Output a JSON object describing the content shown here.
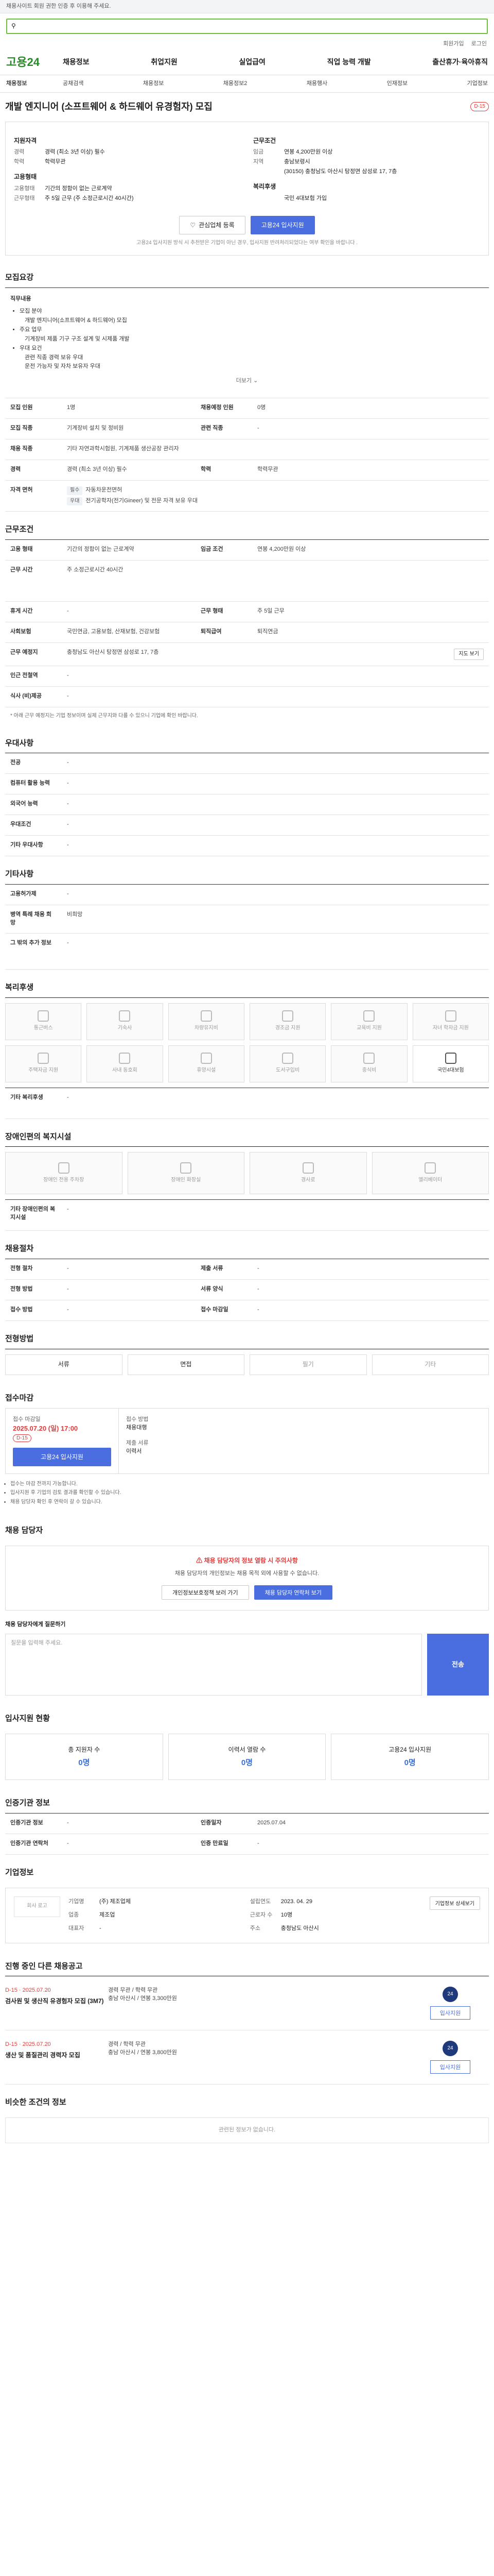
{
  "topbar": {
    "text": "채용사이트 회원 권한 인증 후 이용해 주세요."
  },
  "search": {
    "placeholder": "",
    "button": "검색"
  },
  "util": {
    "links": [
      "회원가입",
      "로그인"
    ]
  },
  "gnb": {
    "logo": "고용24",
    "menu": [
      "채용정보",
      "취업지원",
      "실업급여",
      "직업 능력 개발",
      "출산휴가·육아휴직"
    ]
  },
  "subnav": {
    "first": "채용정보",
    "items": [
      "공채검색",
      "채용정보",
      "채용정보2",
      "채용행사",
      "인재정보",
      "기업정보"
    ]
  },
  "title": {
    "text": "개발 엔지니어 (소프트웨어 & 하드웨어 유경험자) 모집",
    "dday": "D-15"
  },
  "summary": {
    "left_title": "지원자격",
    "left": [
      {
        "k": "경력",
        "v": "경력 (최소 3년 이상) 필수"
      },
      {
        "k": "학력",
        "v": "학력무관"
      }
    ],
    "left2_title": "고용형태",
    "left2": [
      {
        "k": "고용형태",
        "v": "기간의 정함이 없는 근로계약"
      },
      {
        "k": "근무형태",
        "v": "주 5일 근무 (주 소정근로시간 40시간)"
      }
    ],
    "right_title": "근무조건",
    "right": [
      {
        "k": "임금",
        "v": "연봉 4,200만원 이상"
      },
      {
        "k": "지역",
        "v": "충남보령시"
      },
      {
        "k": "",
        "v": "(30150) 충청남도 아산시 탕정면 삼성로 17, 7층"
      }
    ],
    "right2_title": "복리후생",
    "right2": [
      {
        "k": "",
        "v": "국민 4대보험 가입"
      }
    ]
  },
  "actions": {
    "save": "관심업체 등록",
    "apply": "고용24 입사지원",
    "notice": "고용24 입사지원 방식 시 추천받은 기업이 아닌 경우, 입사지원 반려처리되었다는 여부 확인을 바랍니다 ."
  },
  "recruit": {
    "title": "모집요강",
    "desc_title": "직무내용",
    "desc": [
      "모집 분야",
      "개발 엔지니어(소프트웨어 & 하드웨어) 모집",
      "주요 업무",
      "기계장비 제품 기구 구조 설계 및 시제품 개발",
      "우대 요건",
      "관련 직종 경력 보유 우대",
      "운전 가능자 및 자차 보유자 우대"
    ],
    "more": "더보기",
    "rows": [
      {
        "k": "모집 인원",
        "v": "1명",
        "k2": "채용예정 인원",
        "v2": "0명"
      },
      {
        "k": "모집 직종",
        "v": "기계장비 설치 및 정비원",
        "k2": "관련 직종",
        "v2": "-"
      },
      {
        "k": "채용 직종",
        "v": "기타 자연과학시험원, 기계제품 생산공장 관리자",
        "k2": "",
        "v2": ""
      },
      {
        "k": "경력",
        "v": "경력 (최소 3년 이상) 필수",
        "k2": "학력",
        "v2": "학력무관"
      }
    ],
    "cert_k": "자격 면허",
    "cert_tag": "필수",
    "cert_v": "자동차운전면허",
    "cert_tag2": "우대",
    "cert_v2": "전기공학자(전기Gineer) 및 전문 자격 보유 우대"
  },
  "work": {
    "title": "근무조건",
    "rows": [
      {
        "k": "고용 형태",
        "v": "기간의 정함이 없는 근로계약",
        "k2": "임금 조건",
        "v2": "연봉 4,200만원 이상"
      },
      {
        "k": "근무 시간",
        "v": "주 소정근로시간 40시간",
        "k2": "",
        "v2": ""
      },
      {
        "k": "휴게 시간",
        "v": "-",
        "k2": "근무 형태",
        "v2": "주 5일 근무"
      },
      {
        "k": "사회보험",
        "v": "국민연금, 고용보험, 산재보험, 건강보험",
        "k2": "퇴직급여",
        "v2": "퇴직연금"
      },
      {
        "k": "근무 예정지",
        "v": "충청남도 아산시 탕정면 삼성로 17, 7층",
        "k2": "",
        "v2": ""
      },
      {
        "k": "인근 전철역",
        "v": "-",
        "k2": "",
        "v2": ""
      },
      {
        "k": "식사 (비)제공",
        "v": "-",
        "k2": "",
        "v2": ""
      }
    ],
    "map_button": "지도 보기",
    "note": "* 아래 근무 예정지는 기업 정보이며 실제 근무지와 다를 수 있으니 기업에 확인 바랍니다."
  },
  "pref": {
    "title": "우대사항",
    "rows": [
      {
        "k": "전공",
        "v": "-"
      },
      {
        "k": "컴퓨터 활용 능력",
        "v": "-"
      },
      {
        "k": "외국어 능력",
        "v": "-"
      },
      {
        "k": "우대조건",
        "v": "-"
      },
      {
        "k": "기타 우대사항",
        "v": "-"
      }
    ]
  },
  "etc": {
    "title": "기타사항",
    "rows": [
      {
        "k": "고용허가제",
        "v": "-"
      },
      {
        "k": "병역 특례 채용 희망",
        "v": "비희망"
      },
      {
        "k": "그 밖의 추가 정보",
        "v": "-"
      }
    ]
  },
  "welfare": {
    "title": "복리후생",
    "items": [
      {
        "label": "통근버스",
        "on": false
      },
      {
        "label": "기숙사",
        "on": false
      },
      {
        "label": "차량유지비",
        "on": false
      },
      {
        "label": "경조금 지원",
        "on": false
      },
      {
        "label": "교육비 지원",
        "on": false
      },
      {
        "label": "자녀 학자금 지원",
        "on": false
      },
      {
        "label": "주택자금 지원",
        "on": false
      },
      {
        "label": "사내 동호회",
        "on": false
      },
      {
        "label": "휴양시설",
        "on": false
      },
      {
        "label": "도서구입비",
        "on": false
      },
      {
        "label": "중식비",
        "on": false
      },
      {
        "label": "국민4대보험",
        "on": true
      }
    ],
    "other_k": "기타 복리후생",
    "other_v": "-"
  },
  "disabled": {
    "title": "장애인편의 복지시설",
    "items": [
      "장애인 전용 주차장",
      "장애인 화장실",
      "경사로",
      "엘리베이터"
    ],
    "other_k": "기타 장애인편의 복지시설",
    "other_v": "-"
  },
  "location": {
    "title": "채용절차",
    "rows": [
      {
        "k": "전형 절차",
        "v": "-",
        "k2": "제출 서류",
        "v2": "-"
      },
      {
        "k": "전형 방법",
        "v": "-",
        "k2": "서류 양식",
        "v2": "-"
      },
      {
        "k": "접수 방법",
        "v": "-",
        "k2": "접수 마감일",
        "v2": "-"
      }
    ]
  },
  "process": {
    "title": "전형방법",
    "tabs": [
      {
        "label": "서류",
        "on": true
      },
      {
        "label": "면접",
        "on": true
      },
      {
        "label": "필기",
        "on": false
      },
      {
        "label": "기타",
        "on": false
      }
    ]
  },
  "apply": {
    "title": "접수마감",
    "deadline_label": "접수 마감일",
    "deadline": "2025.07.20 (일) 17:00",
    "dday": "D-15",
    "btn": "고용24 입사지원",
    "method_label": "접수 방법",
    "method": "채용대행",
    "docs_label": "제출 서류",
    "docs": "이력서",
    "notes": [
      "접수는 마감 전까지 가능합니다.",
      "입사지원 후 기업의 검토 결과를 확인할 수 있습니다.",
      "채용 담당자 확인 후 연락이 갈 수 있습니다."
    ]
  },
  "manager": {
    "title": "채용 담당자",
    "notice_title": "채용 담당자의 정보 열람 시 주의사항",
    "notice": "채용 담당자의 개인정보는 채용 목적 외에 사용할 수 없습니다.",
    "btn1": "개인정보보호정책 보러 가기",
    "btn2": "채용 담당자 연락처 보기"
  },
  "qa": {
    "title": "채용 담당자에게 질문하기",
    "placeholder": "질문을 입력해 주세요.",
    "btn": "전송"
  },
  "stats": {
    "title": "입사지원 현황",
    "items": [
      {
        "label": "총 지원자 수",
        "n": "0명"
      },
      {
        "label": "이력서 열람 수",
        "n": "0명"
      },
      {
        "label": "고용24 입사지원",
        "n": "0명"
      }
    ]
  },
  "agency": {
    "title": "인증기관 정보",
    "rows": [
      {
        "k": "인증기관 정보",
        "v": "-",
        "k2": "인증일자",
        "v2": "2025.07.04"
      },
      {
        "k": "인증기관 연락처",
        "v": "-",
        "k2": "인증 만료일",
        "v2": "-"
      }
    ]
  },
  "company": {
    "title": "기업정보",
    "logo": "회사 로고",
    "rows": [
      {
        "k": "기업명",
        "v": "(주) 제조업체"
      },
      {
        "k": "업종",
        "v": "제조업"
      },
      {
        "k": "대표자",
        "v": "-"
      },
      {
        "k": "근로자 수",
        "v": "10명"
      },
      {
        "k": "설립연도",
        "v": "2023. 04. 29"
      },
      {
        "k": "주소",
        "v": "충청남도 아산시"
      }
    ],
    "btn": "기업정보 상세보기"
  },
  "other_jobs": {
    "title": "진행 중인 다른 채용공고",
    "items": [
      {
        "dday": "D-15",
        "date": "2025.07.20",
        "name": "검사원 및 생산직 유경험자 모집 (3M7)",
        "exp": "경력 무관",
        "edu": "학력 무관",
        "region": "충남 아산시",
        "wage": "연봉 3,300만원",
        "btn": "입사지원"
      },
      {
        "dday": "D-15",
        "date": "2025.07.20",
        "name": "생산 및 품질관리 경력자 모집",
        "exp": "경력",
        "edu": "학력 무관",
        "region": "충남 아산시",
        "wage": "연봉 3,800만원",
        "btn": "입사지원"
      }
    ]
  },
  "similar": {
    "title": "비슷한 조건의 정보",
    "empty": "관련된 정보가 없습니다."
  }
}
